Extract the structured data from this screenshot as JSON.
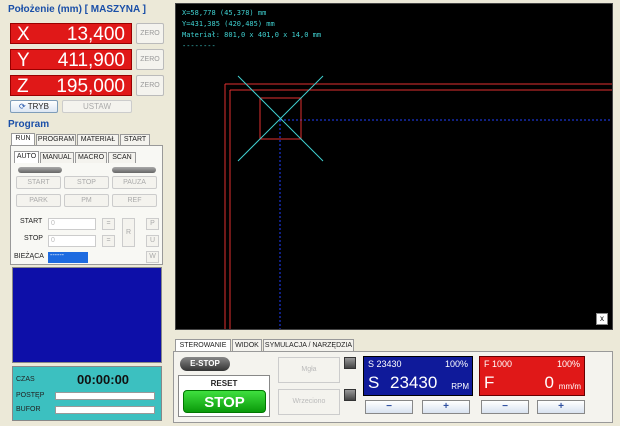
{
  "position": {
    "title": "Położenie (mm) [ MASZYNA ]",
    "axes": [
      {
        "label": "X",
        "value": "13,400",
        "zero": "ZERO"
      },
      {
        "label": "Y",
        "value": "411,900",
        "zero": "ZERO"
      },
      {
        "label": "Z",
        "value": "195,000",
        "zero": "ZERO"
      }
    ],
    "tryb_label": "TRYB",
    "ustaw_label": "USTAW"
  },
  "program": {
    "title": "Program",
    "tabs": [
      "RUN",
      "PROGRAM",
      "MATERIAŁ",
      "START"
    ],
    "subtabs": [
      "AUTO",
      "MANUAL",
      "MACRO",
      "SCAN"
    ],
    "buttons_row1": [
      "START",
      "STOP",
      "PAUZA"
    ],
    "buttons_row2": [
      "PARK",
      "PM",
      "REF"
    ],
    "start_label": "START",
    "stop_label": "STOP",
    "start_value": "0",
    "stop_value": "0",
    "biezaca_label": "BIEŻĄCA",
    "biezaca_value": "------",
    "eq": "=",
    "r_label": "R",
    "p_label": "P",
    "u_label": "U",
    "w_label": "W"
  },
  "status": {
    "czas_label": "CZAS",
    "czas_value": "00:00:00",
    "postep_label": "POSTĘP",
    "bufor_label": "BUFOR"
  },
  "viewport": {
    "line1": "X=58,778 (45,378) mm",
    "line2": "Y=431,385 (420,485) mm",
    "line3": "Materiał: 801,0 x 401,0 x 14,0 mm",
    "line4": "--------",
    "close": "x"
  },
  "bottom": {
    "tabs": [
      "STEROWANIE",
      "WIDOK",
      "SYMULACJA / NARZĘDZIA"
    ],
    "estop": "E-STOP",
    "reset": "RESET",
    "stop": "STOP",
    "mgla": "Mgła",
    "wrzeciono": "Wrzeciono",
    "spindle": {
      "header": "S 23430",
      "pct": "100%",
      "prefix": "S",
      "value": "23430",
      "unit": "RPM"
    },
    "feed": {
      "header": "F 1000",
      "pct": "100%",
      "prefix": "F",
      "value": "0",
      "unit": "mm/m"
    },
    "minus": "−",
    "plus": "+"
  },
  "colors": {
    "axis_bg": "#e01818",
    "spindle_bg": "#0f1a9a",
    "feed_bg": "#e01818",
    "viewport_text": "#3fd0d0"
  }
}
